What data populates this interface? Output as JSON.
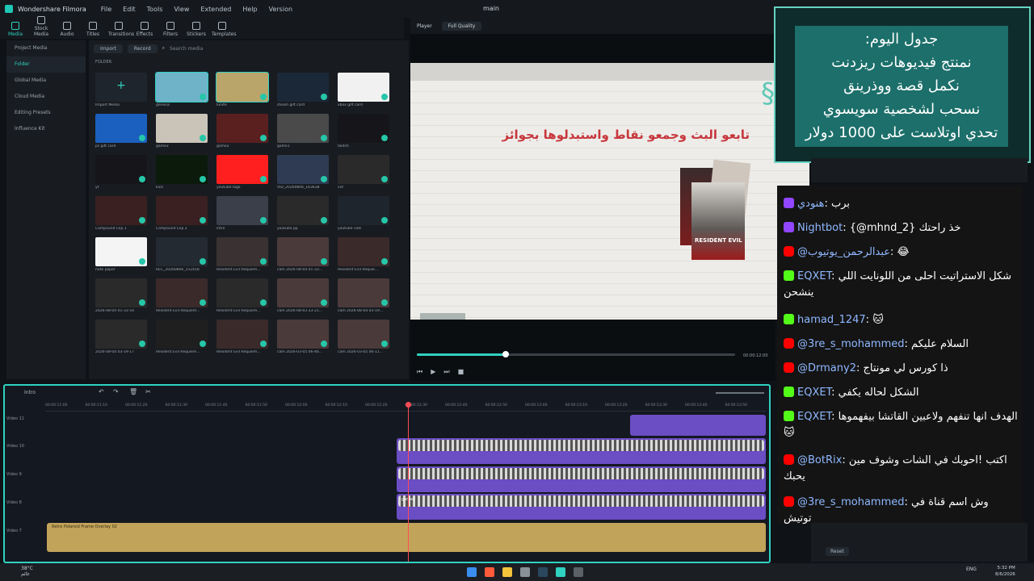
{
  "app": {
    "name": "Wondershare Filmora",
    "document_title": "main",
    "menu": [
      "File",
      "Edit",
      "Tools",
      "View",
      "Extended",
      "Help",
      "Version"
    ]
  },
  "library_tabs": [
    "Media",
    "Stock Media",
    "Audio",
    "Titles",
    "Transitions",
    "Effects",
    "Filters",
    "Stickers",
    "Templates"
  ],
  "sidebar": {
    "items": [
      "Project Media",
      "Folder",
      "Global Media",
      "Cloud Media",
      "Editing Presets",
      "Influence Kit"
    ]
  },
  "media_bin": {
    "import_label": "Import",
    "record_label": "Record",
    "search_placeholder": "Search media",
    "folder_label": "FOLDER",
    "items": [
      {
        "caption": "Import Media",
        "color": "#1f252c"
      },
      {
        "caption": "genesis",
        "color": "#6fb3c9"
      },
      {
        "caption": "lunite",
        "color": "#b9a46a"
      },
      {
        "caption": "steam gift card",
        "color": "#1b2838"
      },
      {
        "caption": "xbox gift card",
        "color": "#f1f1f1"
      },
      {
        "caption": "ps gift card",
        "color": "#1b5fbf"
      },
      {
        "caption": "game3",
        "color": "#c9c3b8"
      },
      {
        "caption": "game2",
        "color": "#5a2020"
      },
      {
        "caption": "game1",
        "color": "#4a4a4a"
      },
      {
        "caption": "twitch",
        "color": "#16161a"
      },
      {
        "caption": "yt",
        "color": "#16161a"
      },
      {
        "caption": "kick",
        "color": "#0b1a0b"
      },
      {
        "caption": "youtube logo",
        "color": "#ff1f1f"
      },
      {
        "caption": "VID_20260806_163638",
        "color": "#2f3b52"
      },
      {
        "caption": "vid",
        "color": "#2a2a2a"
      },
      {
        "caption": "Compound Clip 1",
        "color": "#3a2020"
      },
      {
        "caption": "Compound Clip 2",
        "color": "#3a2020"
      },
      {
        "caption": "intro",
        "color": "#3a3f4a"
      },
      {
        "caption": "youtube pp",
        "color": "#2a2a2a"
      },
      {
        "caption": "youtube vids",
        "color": "#1f252c"
      },
      {
        "caption": "note paper",
        "color": "#f4f4f4"
      },
      {
        "caption": "REC_20260806_152418",
        "color": "#242a31"
      },
      {
        "caption": "Resident Evil Requiem...",
        "color": "#3a3232"
      },
      {
        "caption": "cam 2026-08-04 01-33...",
        "color": "#4a3a3a"
      },
      {
        "caption": "Resident Evil Requie...",
        "color": "#3a2a2a"
      },
      {
        "caption": "2026-08-04 01-33-54",
        "color": "#2a2a2a"
      },
      {
        "caption": "Resident Evil Requiem...",
        "color": "#3a2a2a"
      },
      {
        "caption": "Resident Evil Requiem...",
        "color": "#2a2a2a"
      },
      {
        "caption": "cam 2026-08-03 23-21...",
        "color": "#4a3a3a"
      },
      {
        "caption": "cam 2026-08-04 03-19...",
        "color": "#4a3a3a"
      },
      {
        "caption": "2026-08-04 03-19-17",
        "color": "#2a2a2a"
      },
      {
        "caption": "Resident Evil Requiem...",
        "color": "#1f1f1f"
      },
      {
        "caption": "Resident Evil Requiem...",
        "color": "#3a2a2a"
      },
      {
        "caption": "cam 2026-03-05 06-46...",
        "color": "#4a3a3a"
      },
      {
        "caption": "cam 2026-03-05 06-11...",
        "color": "#4a3a3a"
      }
    ]
  },
  "player": {
    "label": "Player",
    "quality": "Full Quality",
    "timecode": "00:00:12:00",
    "headline": "تابعو البث وجمعو نقاط واستبدلوها بجوائز",
    "poster_text": "RESIDENT EVIL"
  },
  "schedule": {
    "lines": [
      "جدول اليوم:",
      "نمنتج فيديوهات ريزدنت",
      "نكمل قصة ووذرينق",
      "نسحب لشخصية سويسوي",
      "تحدي اوتلاست على 1000 دولار"
    ]
  },
  "chat": {
    "messages": [
      {
        "platform": "twitch",
        "user": "هنودي",
        "text": "برب"
      },
      {
        "platform": "twitch",
        "user": "Nightbot",
        "text": "{@mhnd_2} خذ راحتك"
      },
      {
        "platform": "youtube",
        "user": "@عبدالرحمن_يوتيوب",
        "text": "😂"
      },
      {
        "platform": "kick",
        "user": "EQXET",
        "text": "شكل الاستراتيت احلى من اللونايت اللي ينشحن"
      },
      {
        "platform": "kick",
        "user": "hamad_1247",
        "text": "🐱"
      },
      {
        "platform": "youtube",
        "user": "@3re_s_mohammed",
        "text": "السلام عليكم"
      },
      {
        "platform": "youtube",
        "user": "@Drmany2",
        "text": "ذا كورس لي مونتاج"
      },
      {
        "platform": "kick",
        "user": "EQXET",
        "text": "الشكل لحاله يكفي"
      },
      {
        "platform": "kick",
        "user": "EQXET",
        "text": "الهدف انها تنفهم ولاعبين القاتشا بيفهموها 🐱"
      },
      {
        "platform": "youtube",
        "user": "@BotRix",
        "text": "اكتب !احوبك في الشات وشوف مين يحبك"
      },
      {
        "platform": "youtube",
        "user": "@3re_s_mohammed",
        "text": "وش اسم قناة في توتيش"
      }
    ]
  },
  "right_panel": {
    "reset_label": "Reset"
  },
  "timeline": {
    "sequence_name": "Intro",
    "ruler": [
      "00:00:11:00",
      "00:00:11:10",
      "00:00:11:20",
      "00:00:11:30",
      "00:00:11:40",
      "00:00:11:50",
      "00:00:12:00",
      "00:00:12:10",
      "00:00:12:20",
      "00:00:12:30",
      "00:00:12:40",
      "00:00:12:50",
      "00:00:13:00",
      "00:00:13:10",
      "00:00:13:20",
      "00:00:13:30",
      "00:00:13:40",
      "00:00:13:50"
    ],
    "tracks": [
      "Video 11",
      "Video 10",
      "Video 9",
      "Video 8",
      "Video 7"
    ],
    "overlay_clip_label": "Retro Polaroid Frame Overlay 02",
    "film_clip_label": "game2"
  },
  "taskbar": {
    "weather_temp": "38°C",
    "weather_desc": "غائم",
    "lang": "ENG",
    "time": "5:32 PM",
    "date": "8/6/2026"
  }
}
